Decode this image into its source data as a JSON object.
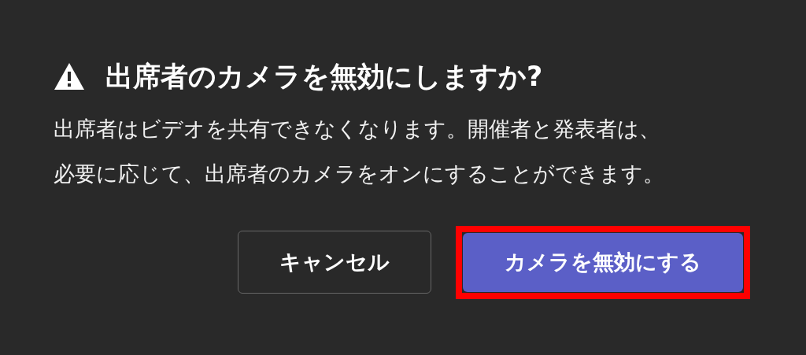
{
  "dialog": {
    "title": "出席者のカメラを無効にしますか?",
    "message_lines": [
      "出席者はビデオを共有できなくなります。開催者と発表者は、",
      "必要に応じて、出席者のカメラをオンにすることができます。"
    ],
    "buttons": [
      {
        "label": "キャンセル",
        "kind": "secondary",
        "highlighted": false
      },
      {
        "label": "カメラを無効にする",
        "kind": "primary",
        "highlighted": true
      }
    ]
  }
}
